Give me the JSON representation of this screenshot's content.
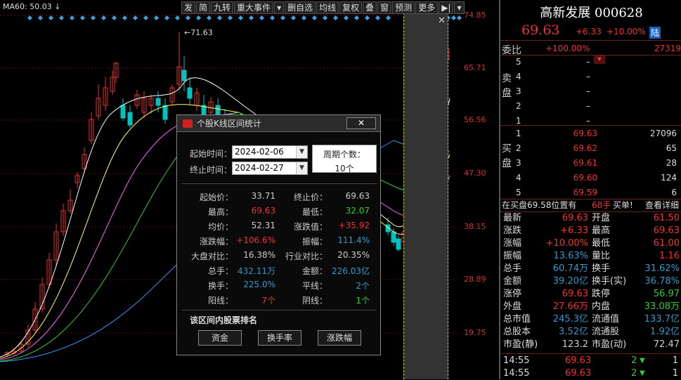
{
  "chart": {
    "ma_label": "MA60: 50.03",
    "ma_arrow": "↓",
    "peak_label": "←71.63",
    "price_ticks": [
      "74.85",
      "65.71",
      "56.56",
      "47.30",
      "38.15",
      "28.89",
      "19.75"
    ],
    "toolbar": [
      "发",
      "简",
      "九转",
      "重大事件",
      "▾",
      "删自选",
      "均线",
      "复权",
      "叠",
      "窗",
      "预测",
      "更多",
      "▶|",
      "▾"
    ],
    "highlight_close": "✕",
    "colors": {
      "up": "#e33333",
      "down": "#00c0c0",
      "grid": "#5a1010"
    }
  },
  "dialog": {
    "title": "个股K线区间统计",
    "close": "✕",
    "start_label": "起始时间：",
    "start_date": "2024-02-06",
    "end_label": "终止时间：",
    "end_date": "2024-02-27",
    "period_label": "周期个数：",
    "period_value": "10个",
    "stats": [
      {
        "label": "起始价：",
        "value": "33.71",
        "color": "white",
        "label2": "终止价：",
        "value2": "69.63",
        "color2": "white"
      },
      {
        "label": "最高：",
        "value": "69.63",
        "color": "red",
        "label2": "最低：",
        "value2": "32.07",
        "color2": "green"
      },
      {
        "label": "均价：",
        "value": "52.31",
        "color": "white",
        "label2": "涨跌值：",
        "value2": "+35.92",
        "color2": "red"
      },
      {
        "label": "涨跌幅：",
        "value": "+106.6%",
        "color": "red",
        "label2": "振幅：",
        "value2": "111.4%",
        "color2": "blue"
      },
      {
        "label": "大盘对比：",
        "value": "16.38%",
        "color": "white",
        "label2": "行业对比：",
        "value2": "20.35%",
        "color2": "white"
      },
      {
        "label": "总手：",
        "value": "432.11万",
        "color": "blue",
        "label2": "金额：",
        "value2": "226.03亿",
        "color2": "blue"
      },
      {
        "label": "换手：",
        "value": "225.0%",
        "color": "blue",
        "label2": "平线：",
        "value2": "2个",
        "color2": "blue"
      },
      {
        "label": "阳线：",
        "value": "7个",
        "color": "red",
        "label2": "阴线：",
        "value2": "1个",
        "color2": "green"
      }
    ],
    "rank_title": "该区间内股票排名",
    "rank_buttons": [
      "资金",
      "换手率",
      "涨跌幅"
    ]
  },
  "quote": {
    "name": "高新发展 000628",
    "price": "69.63",
    "change": "+6.33",
    "pct": "+10.00%",
    "tag": "陆",
    "weibi_label": "委比",
    "weibi_pct": "+100.00%",
    "weibi_val": "27319",
    "sell_label": "卖盘",
    "buy_label": "买盘",
    "sell": [
      {
        "n": "5",
        "p": "–",
        "v": ""
      },
      {
        "n": "4",
        "p": "–",
        "v": ""
      },
      {
        "n": "3",
        "p": "–",
        "v": ""
      },
      {
        "n": "2",
        "p": "–",
        "v": ""
      },
      {
        "n": "1",
        "p": "–",
        "v": ""
      }
    ],
    "buy": [
      {
        "n": "1",
        "p": "69.63",
        "v": "27096"
      },
      {
        "n": "2",
        "p": "69.62",
        "v": "65"
      },
      {
        "n": "3",
        "p": "69.61",
        "v": "28"
      },
      {
        "n": "4",
        "p": "69.60",
        "v": "124"
      },
      {
        "n": "5",
        "p": "69.59",
        "v": "6"
      }
    ],
    "queue_text": "在买盘69.58位置有",
    "queue_count": "68手",
    "queue_buy": "买单!",
    "queue_detail": "查看详细",
    "stats": [
      {
        "l1": "最新",
        "v1": "69.63",
        "c1": "red",
        "l2": "开盘",
        "v2": "61.50",
        "c2": "red"
      },
      {
        "l1": "涨跌",
        "v1": "+6.33",
        "c1": "red",
        "l2": "最高",
        "v2": "69.63",
        "c2": "red"
      },
      {
        "l1": "涨幅",
        "v1": "+10.00%",
        "c1": "red",
        "l2": "最低",
        "v2": "61.00",
        "c2": "red"
      },
      {
        "l1": "振幅",
        "v1": "13.63%",
        "c1": "blue",
        "l2": "量比",
        "v2": "1.16",
        "c2": "red"
      },
      {
        "l1": "总手",
        "v1": "60.74万",
        "c1": "blue",
        "l2": "换手",
        "v2": "31.62%",
        "c2": "blue"
      },
      {
        "l1": "金额",
        "v1": "39.20亿",
        "c1": "blue",
        "l2": "换手(实)",
        "v2": "36.78%",
        "c2": "blue"
      },
      {
        "l1": "涨停",
        "v1": "69.63",
        "c1": "red",
        "l2": "跌停",
        "v2": "56.97",
        "c2": "green"
      },
      {
        "l1": "外盘",
        "v1": "27.66万",
        "c1": "red",
        "l2": "内盘",
        "v2": "33.08万",
        "c2": "green"
      },
      {
        "l1": "总市值",
        "v1": "245.3亿",
        "c1": "blue",
        "l2": "流通值",
        "v2": "133.7亿",
        "c2": "blue"
      },
      {
        "l1": "总股本",
        "v1": "3.52亿",
        "c1": "blue",
        "l2": "流通股",
        "v2": "1.92亿",
        "c2": "blue"
      },
      {
        "l1": "市盈(静)",
        "v1": "123.2",
        "c1": "white",
        "l2": "市盈(动)",
        "v2": "72.47",
        "c2": "white"
      }
    ],
    "ticks": [
      {
        "t": "14:55",
        "p": "69.63",
        "v": "2",
        "d": "1"
      },
      {
        "t": "14:55",
        "p": "69.63",
        "v": "2",
        "d": "1"
      }
    ]
  }
}
